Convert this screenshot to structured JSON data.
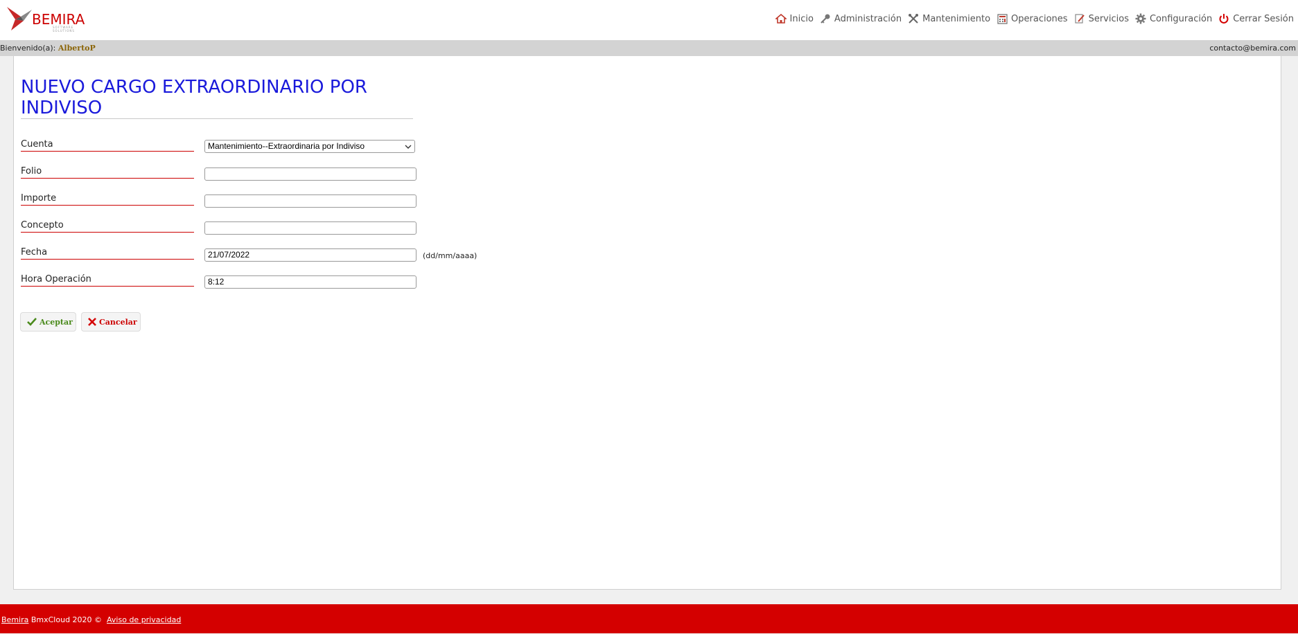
{
  "brand": {
    "name": "BEMIRA",
    "tagline": "SOFTWARE SOLUTIONS"
  },
  "nav": {
    "items": [
      {
        "label": "Inicio",
        "icon": "home-icon"
      },
      {
        "label": "Administración",
        "icon": "key-icon"
      },
      {
        "label": "Mantenimiento",
        "icon": "tools-icon"
      },
      {
        "label": "Operaciones",
        "icon": "calculator-icon"
      },
      {
        "label": "Servicios",
        "icon": "edit-icon"
      },
      {
        "label": "Configuración",
        "icon": "gear-icon"
      },
      {
        "label": "Cerrar Sesión",
        "icon": "power-icon"
      }
    ]
  },
  "welcome": {
    "prefix": "Bienvenido(a):",
    "user": "AlbertoP",
    "contact": "contacto@bemira.com"
  },
  "form": {
    "title": "NUEVO CARGO EXTRAORDINARIO POR INDIVISO",
    "cuenta_label": "Cuenta",
    "cuenta_value": "Mantenimiento--Extraordinaria por Indiviso",
    "folio_label": "Folio",
    "folio_value": "",
    "importe_label": "Importe",
    "importe_value": "",
    "concepto_label": "Concepto",
    "concepto_value": "",
    "fecha_label": "Fecha",
    "fecha_value": "21/07/2022",
    "fecha_hint": "(dd/mm/aaaa)",
    "hora_label": "Hora Operación",
    "hora_value": "8:12",
    "accept_label": "Aceptar",
    "cancel_label": "Cancelar"
  },
  "footer": {
    "brand_link": "Bemira",
    "text": " BmxCloud 2020 © ",
    "privacy_link": "Aviso de privacidad"
  },
  "colors": {
    "title": "#1a1adb",
    "footer_bg": "#d40000",
    "label_underline": "#cc0000",
    "accept": "#4a8a1c",
    "cancel": "#cc0000"
  }
}
